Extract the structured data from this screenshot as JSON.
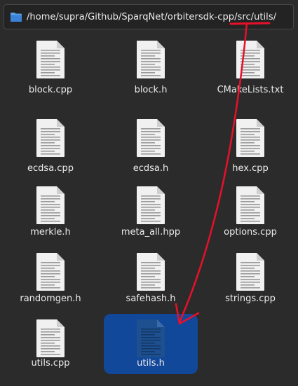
{
  "location_bar": {
    "path": "/home/supra/Github/SparqNet/orbitersdk-cpp/src/utils/"
  },
  "files": [
    {
      "name": "block.cpp",
      "icon": "text-file-icon",
      "selected": false
    },
    {
      "name": "block.h",
      "icon": "text-file-icon",
      "selected": false
    },
    {
      "name": "CMakeLists.txt",
      "icon": "text-file-icon",
      "selected": false
    },
    {
      "name": "ecdsa.cpp",
      "icon": "text-file-icon",
      "selected": false
    },
    {
      "name": "ecdsa.h",
      "icon": "text-file-icon",
      "selected": false
    },
    {
      "name": "hex.cpp",
      "icon": "text-file-icon",
      "selected": false
    },
    {
      "name": "merkle.h",
      "icon": "text-file-icon",
      "selected": false
    },
    {
      "name": "meta_all.hpp",
      "icon": "text-file-icon",
      "selected": false
    },
    {
      "name": "options.cpp",
      "icon": "text-file-icon",
      "selected": false
    },
    {
      "name": "randomgen.h",
      "icon": "text-file-icon",
      "selected": false
    },
    {
      "name": "safehash.h",
      "icon": "text-file-icon",
      "selected": false
    },
    {
      "name": "strings.cpp",
      "icon": "text-file-icon",
      "selected": false
    },
    {
      "name": "utils.cpp",
      "icon": "text-file-icon",
      "selected": false
    },
    {
      "name": "utils.h",
      "icon": "text-file-icon",
      "selected": true
    }
  ],
  "colors": {
    "background": "#2b2b2b",
    "selection": "#12489a",
    "annotation": "#e8102a"
  }
}
